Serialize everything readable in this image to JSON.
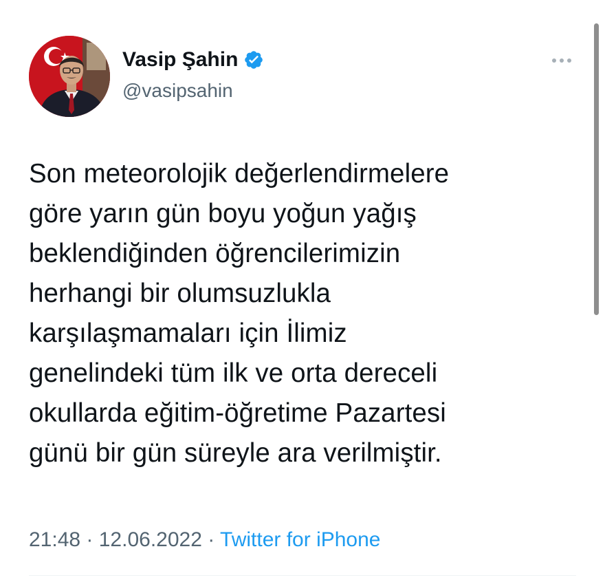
{
  "author": {
    "display_name": "Vasip Şahin",
    "handle": "@vasipsahin",
    "verified": true,
    "avatar_icon": "profile-photo",
    "verified_icon": "verified-badge-icon",
    "verified_color": "#1d9bf0"
  },
  "menu": {
    "icon": "more-options-icon"
  },
  "tweet": {
    "lines": [
      "Son meteorolojik değerlendirmelere",
      "göre yarın gün boyu yoğun yağış",
      "beklendiğinden öğrencilerimizin",
      "herhangi bir olumsuzlukla",
      "karşılaşmamaları için İlimiz",
      "genelindeki tüm ilk ve orta dereceli",
      "okullarda eğitim-öğretime Pazartesi",
      "günü bir gün süreyle ara verilmiştir."
    ]
  },
  "meta": {
    "time": "21:48",
    "separator": "·",
    "date": "12.06.2022",
    "source": "Twitter for iPhone"
  },
  "colors": {
    "text": "#0f1419",
    "secondary": "#536471",
    "link": "#1d9bf0"
  }
}
